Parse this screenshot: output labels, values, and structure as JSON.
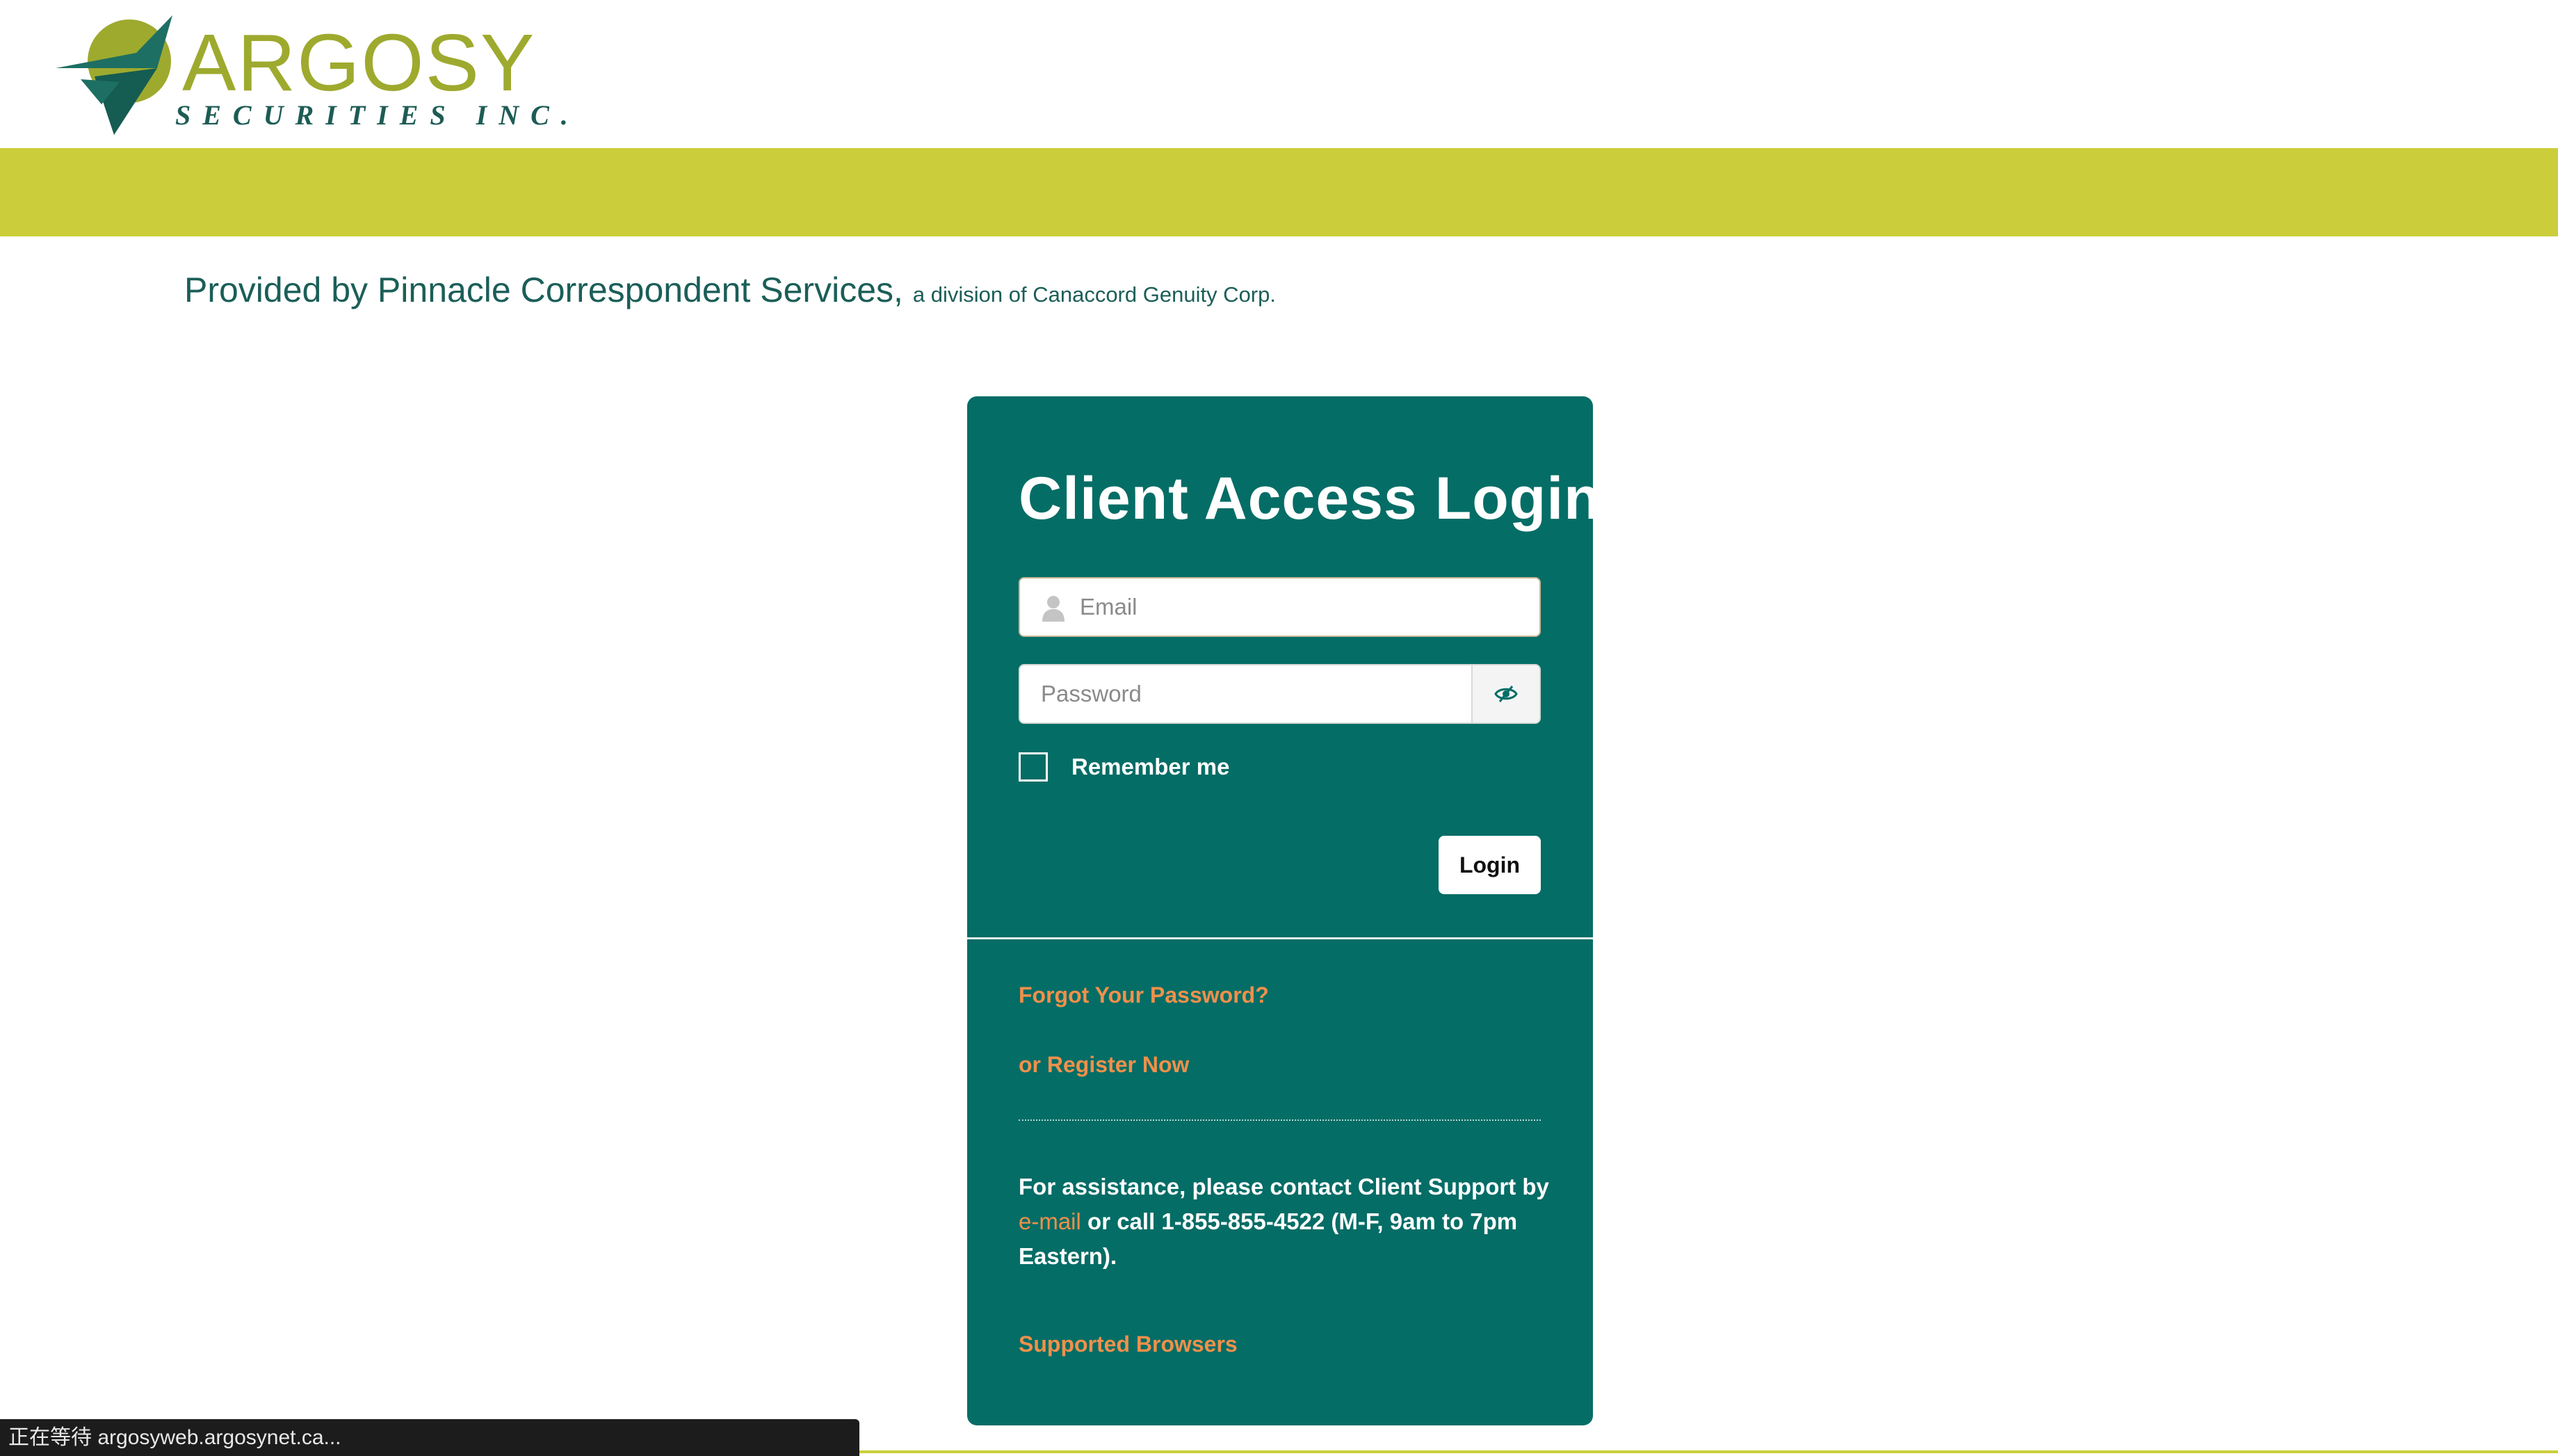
{
  "header": {
    "logo_name": "ARGOSY",
    "logo_sub": "SECURITIES INC.",
    "logo_icon": "bird-arrow-logo",
    "accent_color": "#cbce3a",
    "brand_color": "#046d66"
  },
  "provided_by": {
    "main": "Provided by Pinnacle Correspondent Services,",
    "small": "a division of Canaccord Genuity Corp."
  },
  "login": {
    "title": "Client Access Login",
    "email_placeholder": "Email",
    "email_value": "",
    "password_placeholder": "Password",
    "password_value": "",
    "remember_label": "Remember me",
    "remember_checked": false,
    "login_button": "Login",
    "forgot_link": "Forgot Your Password?",
    "register_link": "or Register Now",
    "assist_text_1": "For assistance, please contact Client Support by",
    "assist_email_link": "e-mail",
    "assist_text_2": "or call 1-855-855-4522 (M-F, 9am to 7pm Eastern).",
    "browsers_link": "Supported Browsers",
    "link_color": "#f0904a"
  },
  "status_bar": {
    "text": "正在等待 argosyweb.argosynet.ca..."
  }
}
